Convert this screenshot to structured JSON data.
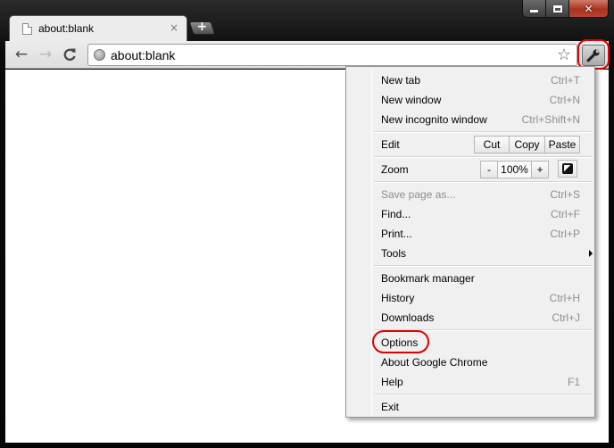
{
  "tab": {
    "title": "about:blank",
    "close_glyph": "×"
  },
  "new_tab_glyph": "+",
  "caption": {
    "close_glyph": "✕"
  },
  "toolbar": {
    "back_glyph": "←",
    "forward_glyph": "→",
    "reload_glyph": "C",
    "url": "about:blank",
    "star_glyph": "☆"
  },
  "menu": {
    "new_tab": {
      "label": "New tab",
      "shortcut": "Ctrl+T"
    },
    "new_window": {
      "label": "New window",
      "shortcut": "Ctrl+N"
    },
    "new_incognito": {
      "label": "New incognito window",
      "shortcut": "Ctrl+Shift+N"
    },
    "edit": {
      "label": "Edit",
      "cut": "Cut",
      "copy": "Copy",
      "paste": "Paste"
    },
    "zoom": {
      "label": "Zoom",
      "minus": "-",
      "value": "100%",
      "plus": "+"
    },
    "save_page": {
      "label": "Save page as...",
      "shortcut": "Ctrl+S"
    },
    "find": {
      "label": "Find...",
      "shortcut": "Ctrl+F"
    },
    "print": {
      "label": "Print...",
      "shortcut": "Ctrl+P"
    },
    "tools": {
      "label": "Tools"
    },
    "bookmark_manager": {
      "label": "Bookmark manager"
    },
    "history": {
      "label": "History",
      "shortcut": "Ctrl+H"
    },
    "downloads": {
      "label": "Downloads",
      "shortcut": "Ctrl+J"
    },
    "options": {
      "label": "Options"
    },
    "about": {
      "label": "About Google Chrome"
    },
    "help": {
      "label": "Help",
      "shortcut": "F1"
    },
    "exit": {
      "label": "Exit"
    }
  },
  "colors": {
    "highlight_ring": "#e00000",
    "menu_bg": "#f0f0f0",
    "frame": "#0a0a0a"
  }
}
